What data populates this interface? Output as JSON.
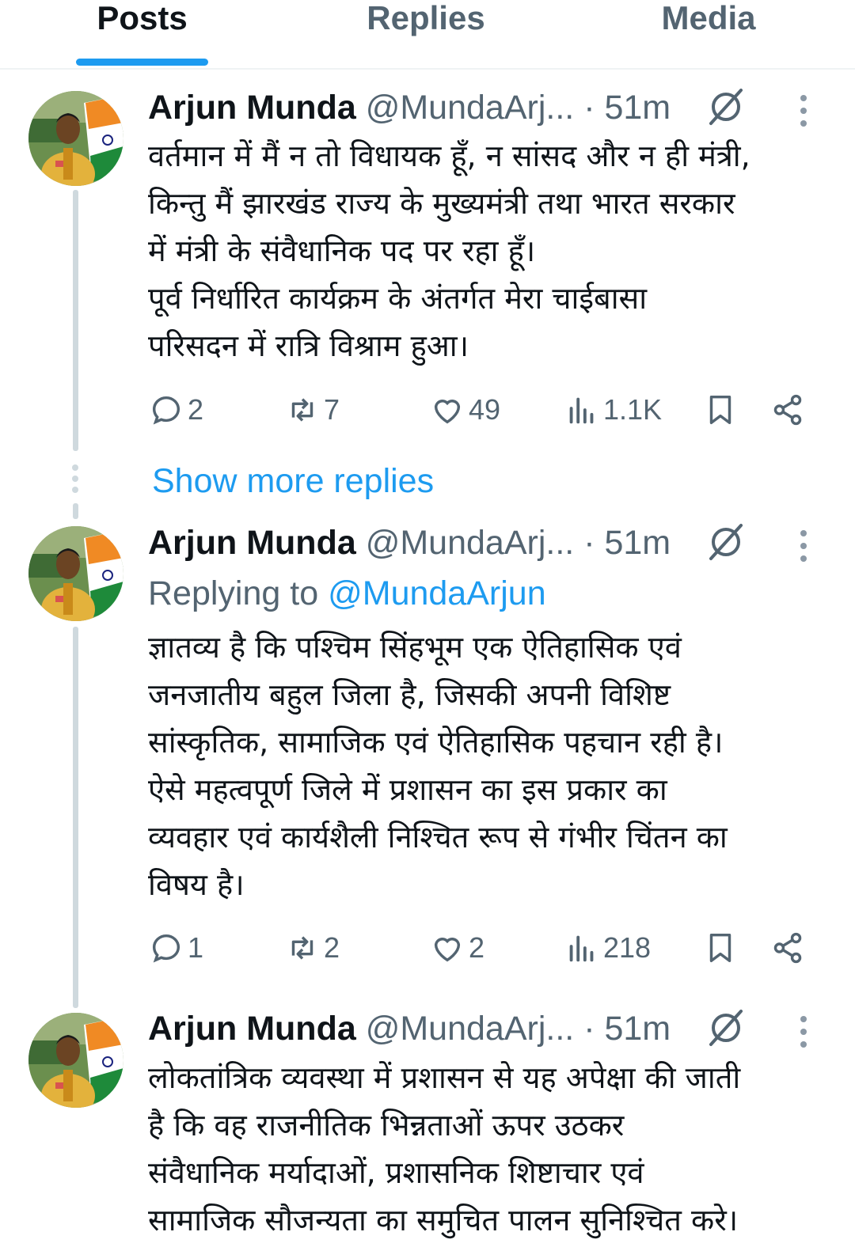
{
  "tabs": [
    {
      "label": "Posts",
      "active": true
    },
    {
      "label": "Replies",
      "active": false
    },
    {
      "label": "Media",
      "active": false
    }
  ],
  "show_more": "Show more replies",
  "posts": [
    {
      "name": "Arjun Munda",
      "handle": "@MundaArj...",
      "dot": "·",
      "time": "51m",
      "text": "वर्तमान में मैं न तो विधायक हूँ, न सांसद और न ही मंत्री,\nकिन्तु मैं झारखंड राज्य के मुख्यमंत्री तथा भारत सरकार\nमें मंत्री के संवैधानिक पद पर रहा हूँ।\nपूर्व निर्धारित कार्यक्रम के अंतर्गत मेरा चाईबासा\nपरिसदन में रात्रि विश्राम हुआ।",
      "replies": "2",
      "reposts": "7",
      "likes": "49",
      "views": "1.1K"
    },
    {
      "name": "Arjun Munda",
      "handle": "@MundaArj...",
      "dot": "·",
      "time": "51m",
      "replying_prefix": "Replying to",
      "replying_to": "@MundaArjun",
      "text": "ज्ञातव्य है कि पश्चिम सिंहभूम एक ऐतिहासिक एवं\nजनजातीय बहुल जिला है, जिसकी अपनी विशिष्ट\nसांस्कृतिक, सामाजिक एवं ऐतिहासिक पहचान रही है।\nऐसे महत्वपूर्ण जिले में प्रशासन का इस प्रकार का\nव्यवहार एवं कार्यशैली निश्चित रूप से गंभीर चिंतन का\nविषय है।",
      "replies": "1",
      "reposts": "2",
      "likes": "2",
      "views": "218"
    },
    {
      "name": "Arjun Munda",
      "handle": "@MundaArj...",
      "dot": "·",
      "time": "51m",
      "text": "लोकतांत्रिक व्यवस्था में प्रशासन से यह अपेक्षा की जाती\nहै कि वह राजनीतिक भिन्नताओं ऊपर उठकर\nसंवैधानिक मर्यादाओं, प्रशासनिक शिष्टाचार एवं\nसामाजिक सौजन्यता का समुचित पालन सुनिश्चित करे।"
    }
  ],
  "colors": {
    "accent": "#1d9bf0",
    "secondary_text": "#536471",
    "primary_text": "#0f1419"
  }
}
